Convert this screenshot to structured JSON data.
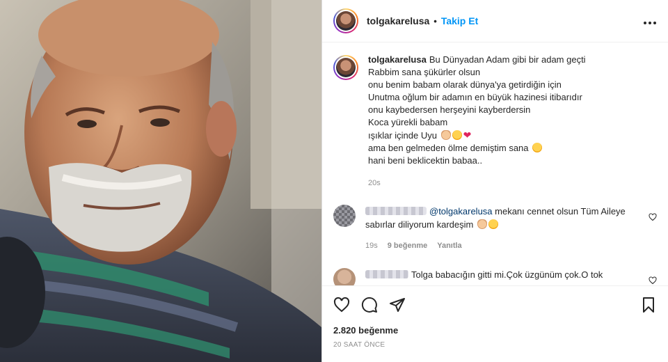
{
  "post": {
    "username": "tolgakarelusa",
    "separator": "•",
    "follow_label": "Takip Et",
    "more_label": "•••",
    "caption_lines": [
      "Bu Dünyadan Adam gibi bir adam geçti",
      "Rabbim sana şükürler olsun",
      "onu benim babam olarak dünya'ya getirdiğin için",
      "Unutma oğlum bir adamın en büyük hazinesi itibarıdır",
      "onu kaybedersen herşeyini kayberdersin",
      "Koca yürekli babam",
      "ışıklar içinde Uyu",
      "ama ben gelmeden ölme demiştim sana",
      "hani beni beklicektin babaa.."
    ],
    "caption_time": "20s"
  },
  "comments": [
    {
      "mention": "@tolgakarelusa",
      "text": " mekanı cennet olsun Tüm Aileye sabırlar diliyorum kardeşim",
      "time": "19s",
      "likes": "9 beğenme",
      "reply": "Yanıtla"
    },
    {
      "text": "Tolga babacığın gitti mi.Çok üzgünüm çok.O tok"
    }
  ],
  "footer": {
    "likes_count": "2.820 beğenme",
    "posted_ago": "20 SAAT ÖNCE"
  },
  "icons": {
    "like": "heart-outline-icon",
    "comment": "speech-bubble-icon",
    "share": "paper-plane-icon",
    "save": "bookmark-icon"
  },
  "colors": {
    "follow": "#0095f6",
    "meta": "#8e8e8e",
    "mention": "#00376b"
  }
}
